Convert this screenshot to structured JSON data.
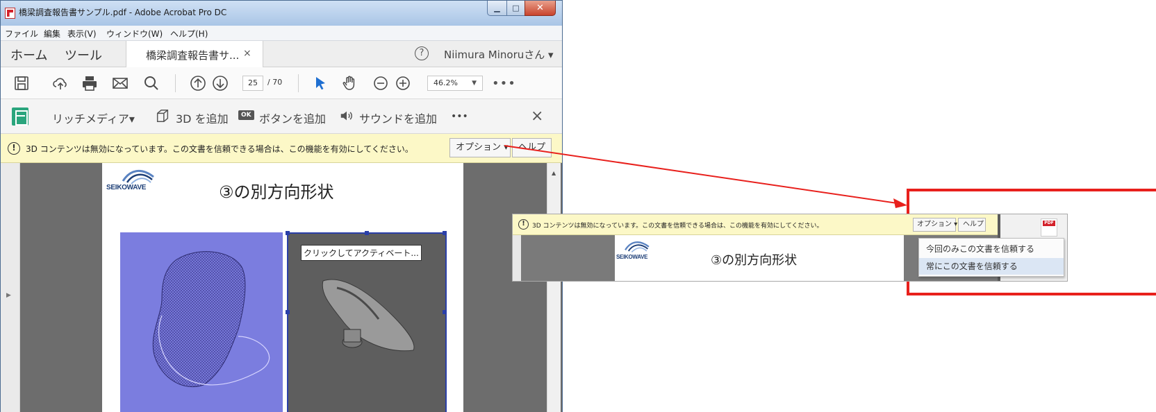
{
  "window": {
    "title": "橋梁調査報告書サンプル.pdf - Adobe Acrobat Pro DC",
    "controls": {
      "minimize_icon": "minimize-icon",
      "maximize_icon": "maximize-icon",
      "close_icon": "close-icon"
    }
  },
  "menu": {
    "items": [
      "ファイル",
      "編集",
      "表示(V)",
      "ウィンドウ(W)",
      "ヘルプ(H)"
    ]
  },
  "tabs": {
    "home": "ホーム",
    "tools": "ツール",
    "document": "橋梁調査報告書サ...",
    "document_close": "×",
    "help_icon": "?",
    "user": "Niimura Minoruさん ▾"
  },
  "toolbar": {
    "page_current": "25",
    "page_total": "/ 70",
    "zoom": "46.2%",
    "zoom_caret": "▼",
    "more": "•••"
  },
  "richmedia": {
    "label": "リッチメディア▾",
    "add_3d": "3D を追加",
    "add_button": "ボタンを追加",
    "ok_badge": "OK",
    "add_sound": "サウンドを追加",
    "more": "•••",
    "close": "×"
  },
  "warning": {
    "icon": "!",
    "message": "3D コンテンツは無効になっています。この文書を信頼できる場合は、この機能を有効にしてください。",
    "options_label": "オプション ▾",
    "help_label": "ヘルプ"
  },
  "document": {
    "logo_text": "SEIKOWAVE",
    "heading": "③の別方向形状",
    "activate_tooltip": "クリックしてアクティベート..."
  },
  "inset": {
    "warning_message": "3D コンテンツは無効になっています。この文書を信頼できる場合は、この機能を有効にしてください。",
    "options_label": "オプション ▾",
    "help_label": "ヘルプ",
    "logo_text": "SEIKOWAVE",
    "heading": "③の別方向形状",
    "pdf_badge": "PDF",
    "dropdown": [
      "今回のみこの文書を信頼する",
      "常にこの文書を信頼する"
    ]
  },
  "colors": {
    "accent_red": "#e8201c",
    "warning_bg": "#fcf8c7",
    "rich_green": "#2aa57d",
    "selection_blue": "#2a3fa8"
  }
}
